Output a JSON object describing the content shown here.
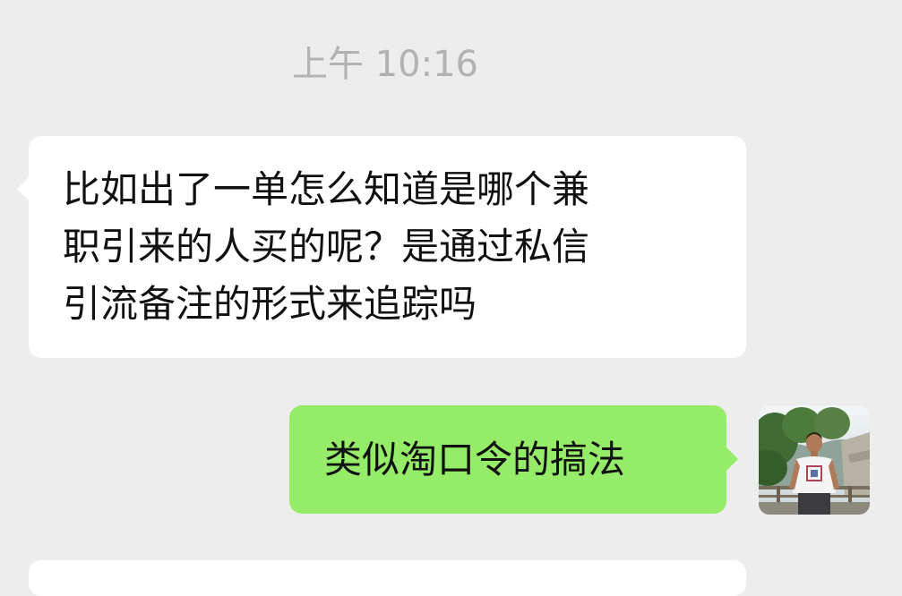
{
  "chat": {
    "timestamp": "上午 10:16",
    "messages": [
      {
        "sender": "other",
        "lines": [
          "比如出了一单怎么知道是哪个兼",
          "职引来的人买的呢？是通过私信",
          "引流备注的形式来追踪吗"
        ]
      },
      {
        "sender": "me",
        "text": "类似淘口令的搞法"
      }
    ]
  },
  "colors": {
    "background": "#ededed",
    "incoming_bubble": "#ffffff",
    "outgoing_bubble": "#95ec69",
    "timestamp_text": "#b2b2b2",
    "message_text": "#111111"
  },
  "icons": {
    "avatar": "avatar-photo"
  }
}
